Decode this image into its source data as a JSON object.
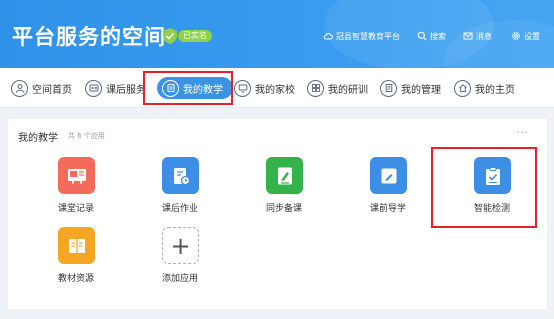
{
  "header": {
    "title": "平台服务的空间",
    "verified_badge": "已实名",
    "nav": [
      {
        "label": "冠县智慧教育平台",
        "icon": "cloud-icon"
      },
      {
        "label": "搜索",
        "icon": "search-icon"
      },
      {
        "label": "消息",
        "icon": "mail-icon"
      },
      {
        "label": "设置",
        "icon": "gear-icon"
      }
    ]
  },
  "tabs": [
    {
      "label": "空间首页",
      "icon": "user-icon"
    },
    {
      "label": "课后服务",
      "icon": "id-card-icon"
    },
    {
      "label": "我的教学",
      "icon": "book-icon",
      "active": true
    },
    {
      "label": "我的家校",
      "icon": "monitor-icon"
    },
    {
      "label": "我的研训",
      "icon": "grid-icon"
    },
    {
      "label": "我的管理",
      "icon": "document-icon"
    },
    {
      "label": "我的主页",
      "icon": "home-icon"
    }
  ],
  "panel": {
    "title": "我的教学",
    "count": "共 6 个应用",
    "more": "···",
    "apps": [
      {
        "label": "课堂记录",
        "color": "#f26b5b",
        "icon": "classroom-icon"
      },
      {
        "label": "课后作业",
        "color": "#3d8fe6",
        "icon": "homework-icon"
      },
      {
        "label": "同步备课",
        "color": "#34b24c",
        "icon": "lesson-prep-icon"
      },
      {
        "label": "课前导学",
        "color": "#3d8fe6",
        "icon": "pre-class-icon"
      },
      {
        "label": "智能检测",
        "color": "#3d8fe6",
        "icon": "clipboard-check-icon"
      },
      {
        "label": "教材资源",
        "color": "#f5a623",
        "icon": "textbook-icon"
      },
      {
        "label": "添加应用",
        "icon": "plus-icon",
        "glyph": "+"
      }
    ]
  },
  "colors": {
    "header_bg": "#3a9cf0",
    "active_tab": "#3a93e4",
    "highlight": "#e8202a"
  }
}
